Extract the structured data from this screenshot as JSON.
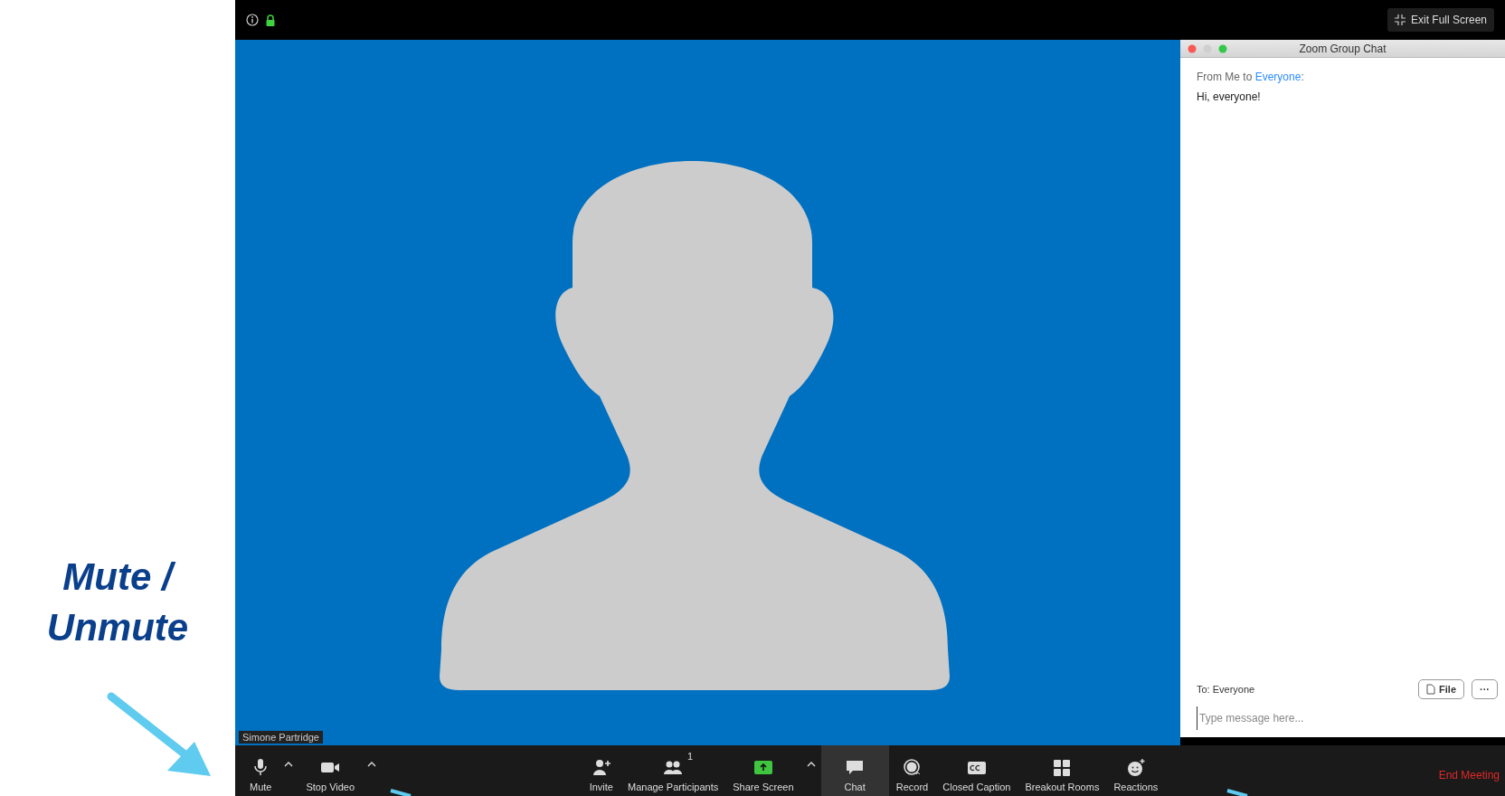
{
  "annotation": {
    "lines": [
      "Mute /",
      "Unmute"
    ]
  },
  "top_bar": {
    "exit_button": "Exit Full Screen"
  },
  "video": {
    "participant_name": "Simone Partridge"
  },
  "chat": {
    "title": "Zoom Group Chat",
    "message": {
      "prefix": "From Me to",
      "recipient": "Everyone",
      "suffix": ":",
      "text": "Hi, everyone!"
    },
    "to_label": "To: Everyone",
    "file_button": "File",
    "more_button": "···",
    "placeholder": "Type message here..."
  },
  "toolbar": {
    "left": [
      {
        "kind": "mic",
        "label": "Mute",
        "selected": false
      },
      {
        "kind": "caret",
        "selected": false
      },
      {
        "kind": "camera",
        "label": "Stop Video",
        "selected": false
      },
      {
        "kind": "caret",
        "selected": false
      }
    ],
    "center": [
      {
        "kind": "invite",
        "label": "Invite",
        "selected": false
      },
      {
        "kind": "participants",
        "label": "Manage Participants",
        "count": "1",
        "selected": false
      },
      {
        "kind": "share",
        "label": "Share Screen",
        "selected": false
      },
      {
        "kind": "caret",
        "selected": false
      },
      {
        "kind": "chat",
        "label": "Chat",
        "selected": true
      },
      {
        "kind": "record",
        "label": "Record",
        "selected": false
      },
      {
        "kind": "cc",
        "label": "Closed Caption",
        "selected": false
      },
      {
        "kind": "breakout",
        "label": "Breakout Rooms",
        "selected": false
      },
      {
        "kind": "reactions",
        "label": "Reactions",
        "selected": false
      }
    ],
    "end_button": "End Meeting"
  }
}
